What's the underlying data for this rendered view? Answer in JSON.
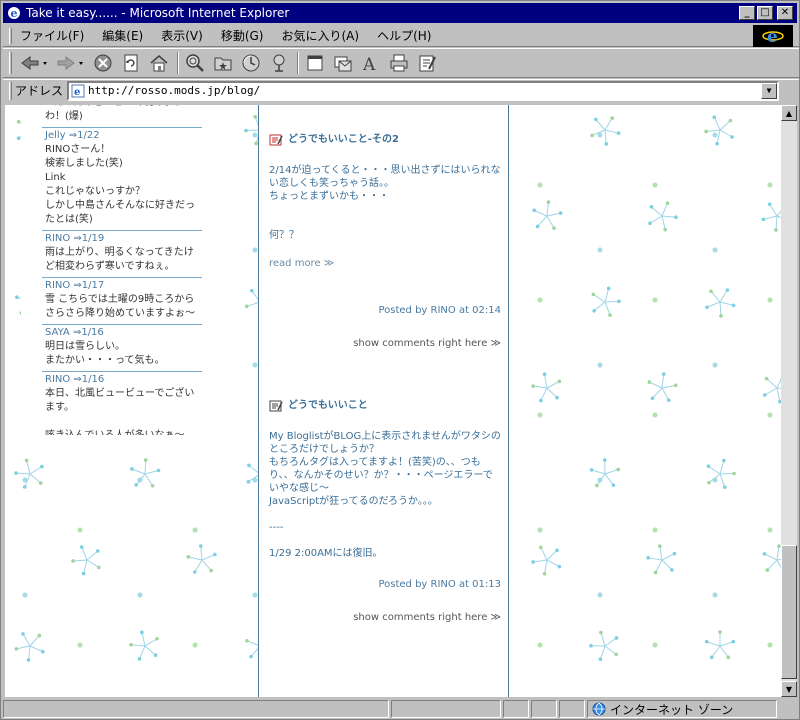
{
  "window": {
    "title": "Take it easy...... - Microsoft Internet Explorer"
  },
  "menu": [
    "ファイル(F)",
    "編集(E)",
    "表示(V)",
    "移動(G)",
    "お気に入り(A)",
    "ヘルプ(H)"
  ],
  "address": {
    "label": "アドレス",
    "url": "http://rosso.mods.jp/blog/"
  },
  "status": {
    "zone": "インターネット ゾーン"
  },
  "sidebar": {
    "comments": [
      {
        "header": "",
        "body": "~たのだけど！ビルで眺めようわ！(爆)"
      },
      {
        "header": "Jelly ⇒1/22",
        "body": "RINOさーん！\n検索しました(笑)\nLink\nこれじゃないっすか？\nしかし中島さんそんなに好きだったとは(笑)"
      },
      {
        "header": "RINO ⇒1/19",
        "body": "雨は上がり、明るくなってきたけど相変わらず寒いですねぇ。"
      },
      {
        "header": "RINO ⇒1/17",
        "body": "雪 こちらでは土曜の9時ころからさらさら降り始めていますよぉ～"
      },
      {
        "header": "SAYA ⇒1/16",
        "body": "明日は雪らしい。\nまたかい・・・って気も。"
      },
      {
        "header": "RINO ⇒1/16",
        "body": "本日、北風ビュービューでございます。\n\n咳き込んでいる人が多いなぁ～"
      }
    ]
  },
  "posts": [
    {
      "title": "どうでもいいこと-その2",
      "body": "2/14が迫ってくると・・・思い出さずにはいられない恋しくも笑っちゃう話。。\nちょっとまずいかも・・・\n\n\n何？？",
      "readmore": "read more ≫",
      "posted": "Posted by RINO at 02:14",
      "comments": "show comments right here ≫"
    },
    {
      "title": "どうでもいいこと",
      "body": "My BloglistがBLOG上に表示されませんがワタシのところだけでしょうか？\nもちろんタグは入ってますよ！(苦笑)の、、つもり、、なんかそのせい？か？・・・ページエラーでいやな感じ～\nJavaScriptが狂ってるのだろうか。。。\n\n----\n\n1/29 2:00AMには復旧。",
      "posted": "Posted by RINO at 01:13",
      "comments": "show comments right here ≫"
    }
  ],
  "colors": {
    "titlebar": "#00007f",
    "accent": "#3a6e96",
    "chrome": "#c0c0c0"
  }
}
